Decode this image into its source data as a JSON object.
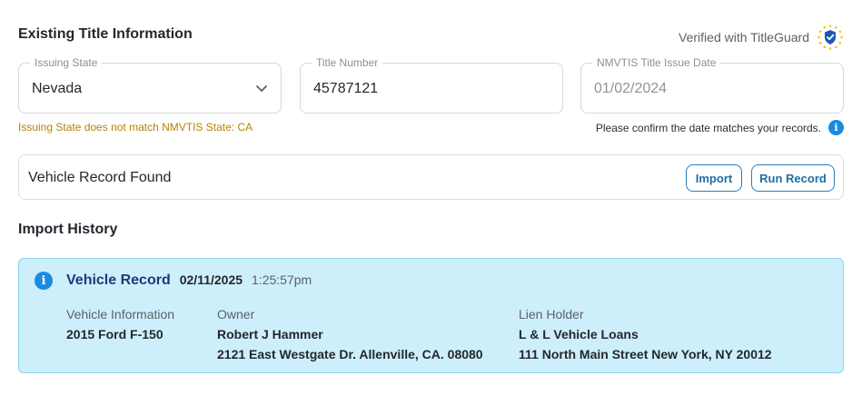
{
  "header": {
    "title": "Existing Title Information",
    "verified_text": "Verified with TitleGuard"
  },
  "fields": {
    "issuing_state": {
      "label": "Issuing State",
      "value": "Nevada"
    },
    "title_number": {
      "label": "Title Number",
      "value": "45787121"
    },
    "issue_date": {
      "label": "NMVTIS Title Issue Date",
      "value": "01/02/2024"
    }
  },
  "messages": {
    "state_warning": "Issuing State does not match NMVTIS State: CA",
    "date_confirm": "Please confirm the date matches your records."
  },
  "record_bar": {
    "title": "Vehicle Record Found",
    "import_label": "Import",
    "run_label": "Run Record"
  },
  "history": {
    "title": "Import History",
    "entry": {
      "name": "Vehicle Record",
      "date": "02/11/2025",
      "time": "1:25:57pm",
      "vehicle_label": "Vehicle Information",
      "vehicle_value": "2015 Ford F-150",
      "owner_label": "Owner",
      "owner_name": "Robert J Hammer",
      "owner_address": "2121 East Westgate Dr. Allenville, CA. 08080",
      "lien_label": "Lien Holder",
      "lien_name": "L & L Vehicle Loans",
      "lien_address": "111 North Main Street New York, NY 20012"
    }
  },
  "colors": {
    "accent": "#1f6e9f",
    "warning": "#b88300",
    "info": "#1a8be0",
    "card_bg": "#cdeffb"
  },
  "icons": [
    "titleguard-badge-icon",
    "chevron-down-icon",
    "info-icon"
  ]
}
